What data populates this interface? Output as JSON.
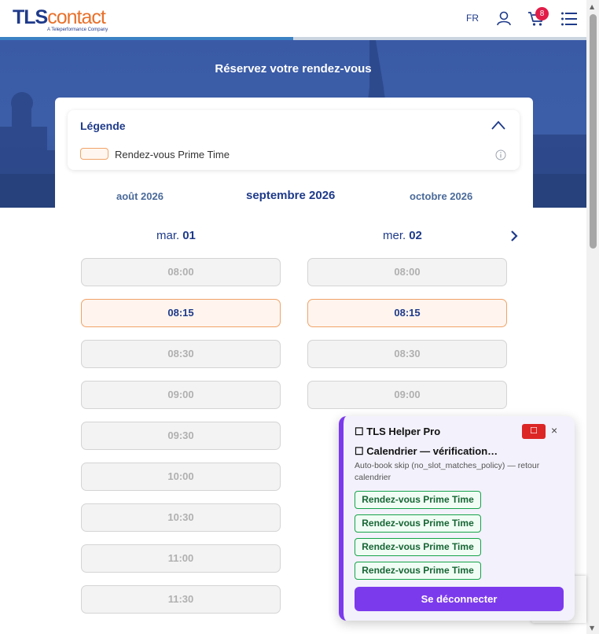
{
  "header": {
    "logo_tls": "TLS",
    "logo_contact": "contact",
    "logo_sub": "A Teleperformance Company",
    "lang": "FR",
    "cart_count": "8",
    "progress_fraction": 0.5
  },
  "hero": {
    "title": "Réservez votre rendez-vous"
  },
  "legend": {
    "title": "Légende",
    "prime_label": "Rendez-vous Prime Time"
  },
  "calendar": {
    "prev_month": "août 2026",
    "current_month": "septembre 2026",
    "next_month": "octobre 2026",
    "days": [
      {
        "weekday": "mar.",
        "num": "01"
      },
      {
        "weekday": "mer.",
        "num": "02"
      }
    ],
    "col1_slots": [
      "08:00",
      "08:15",
      "08:30",
      "09:00",
      "09:30",
      "10:00",
      "10:30",
      "11:00",
      "11:30"
    ],
    "col2_slots": [
      "08:00",
      "08:15",
      "08:30",
      "09:00"
    ],
    "prime_slot": "08:15"
  },
  "popup": {
    "title": "☐ TLS Helper Pro",
    "red_button": "☐",
    "close": "×",
    "subtitle": "☐ Calendrier — vérification…",
    "description": "Auto-book skip (no_slot_matches_policy) — retour calendrier",
    "tags": [
      "Rendez-vous Prime Time",
      "Rendez-vous Prime Time",
      "Rendez-vous Prime Time",
      "Rendez-vous Prime Time"
    ],
    "logout": "Se déconnecter"
  },
  "colors": {
    "brand_blue": "#1e3a8a",
    "brand_orange": "#e8702a",
    "prime_border": "#f0a368",
    "popup_accent": "#7c3aed"
  }
}
